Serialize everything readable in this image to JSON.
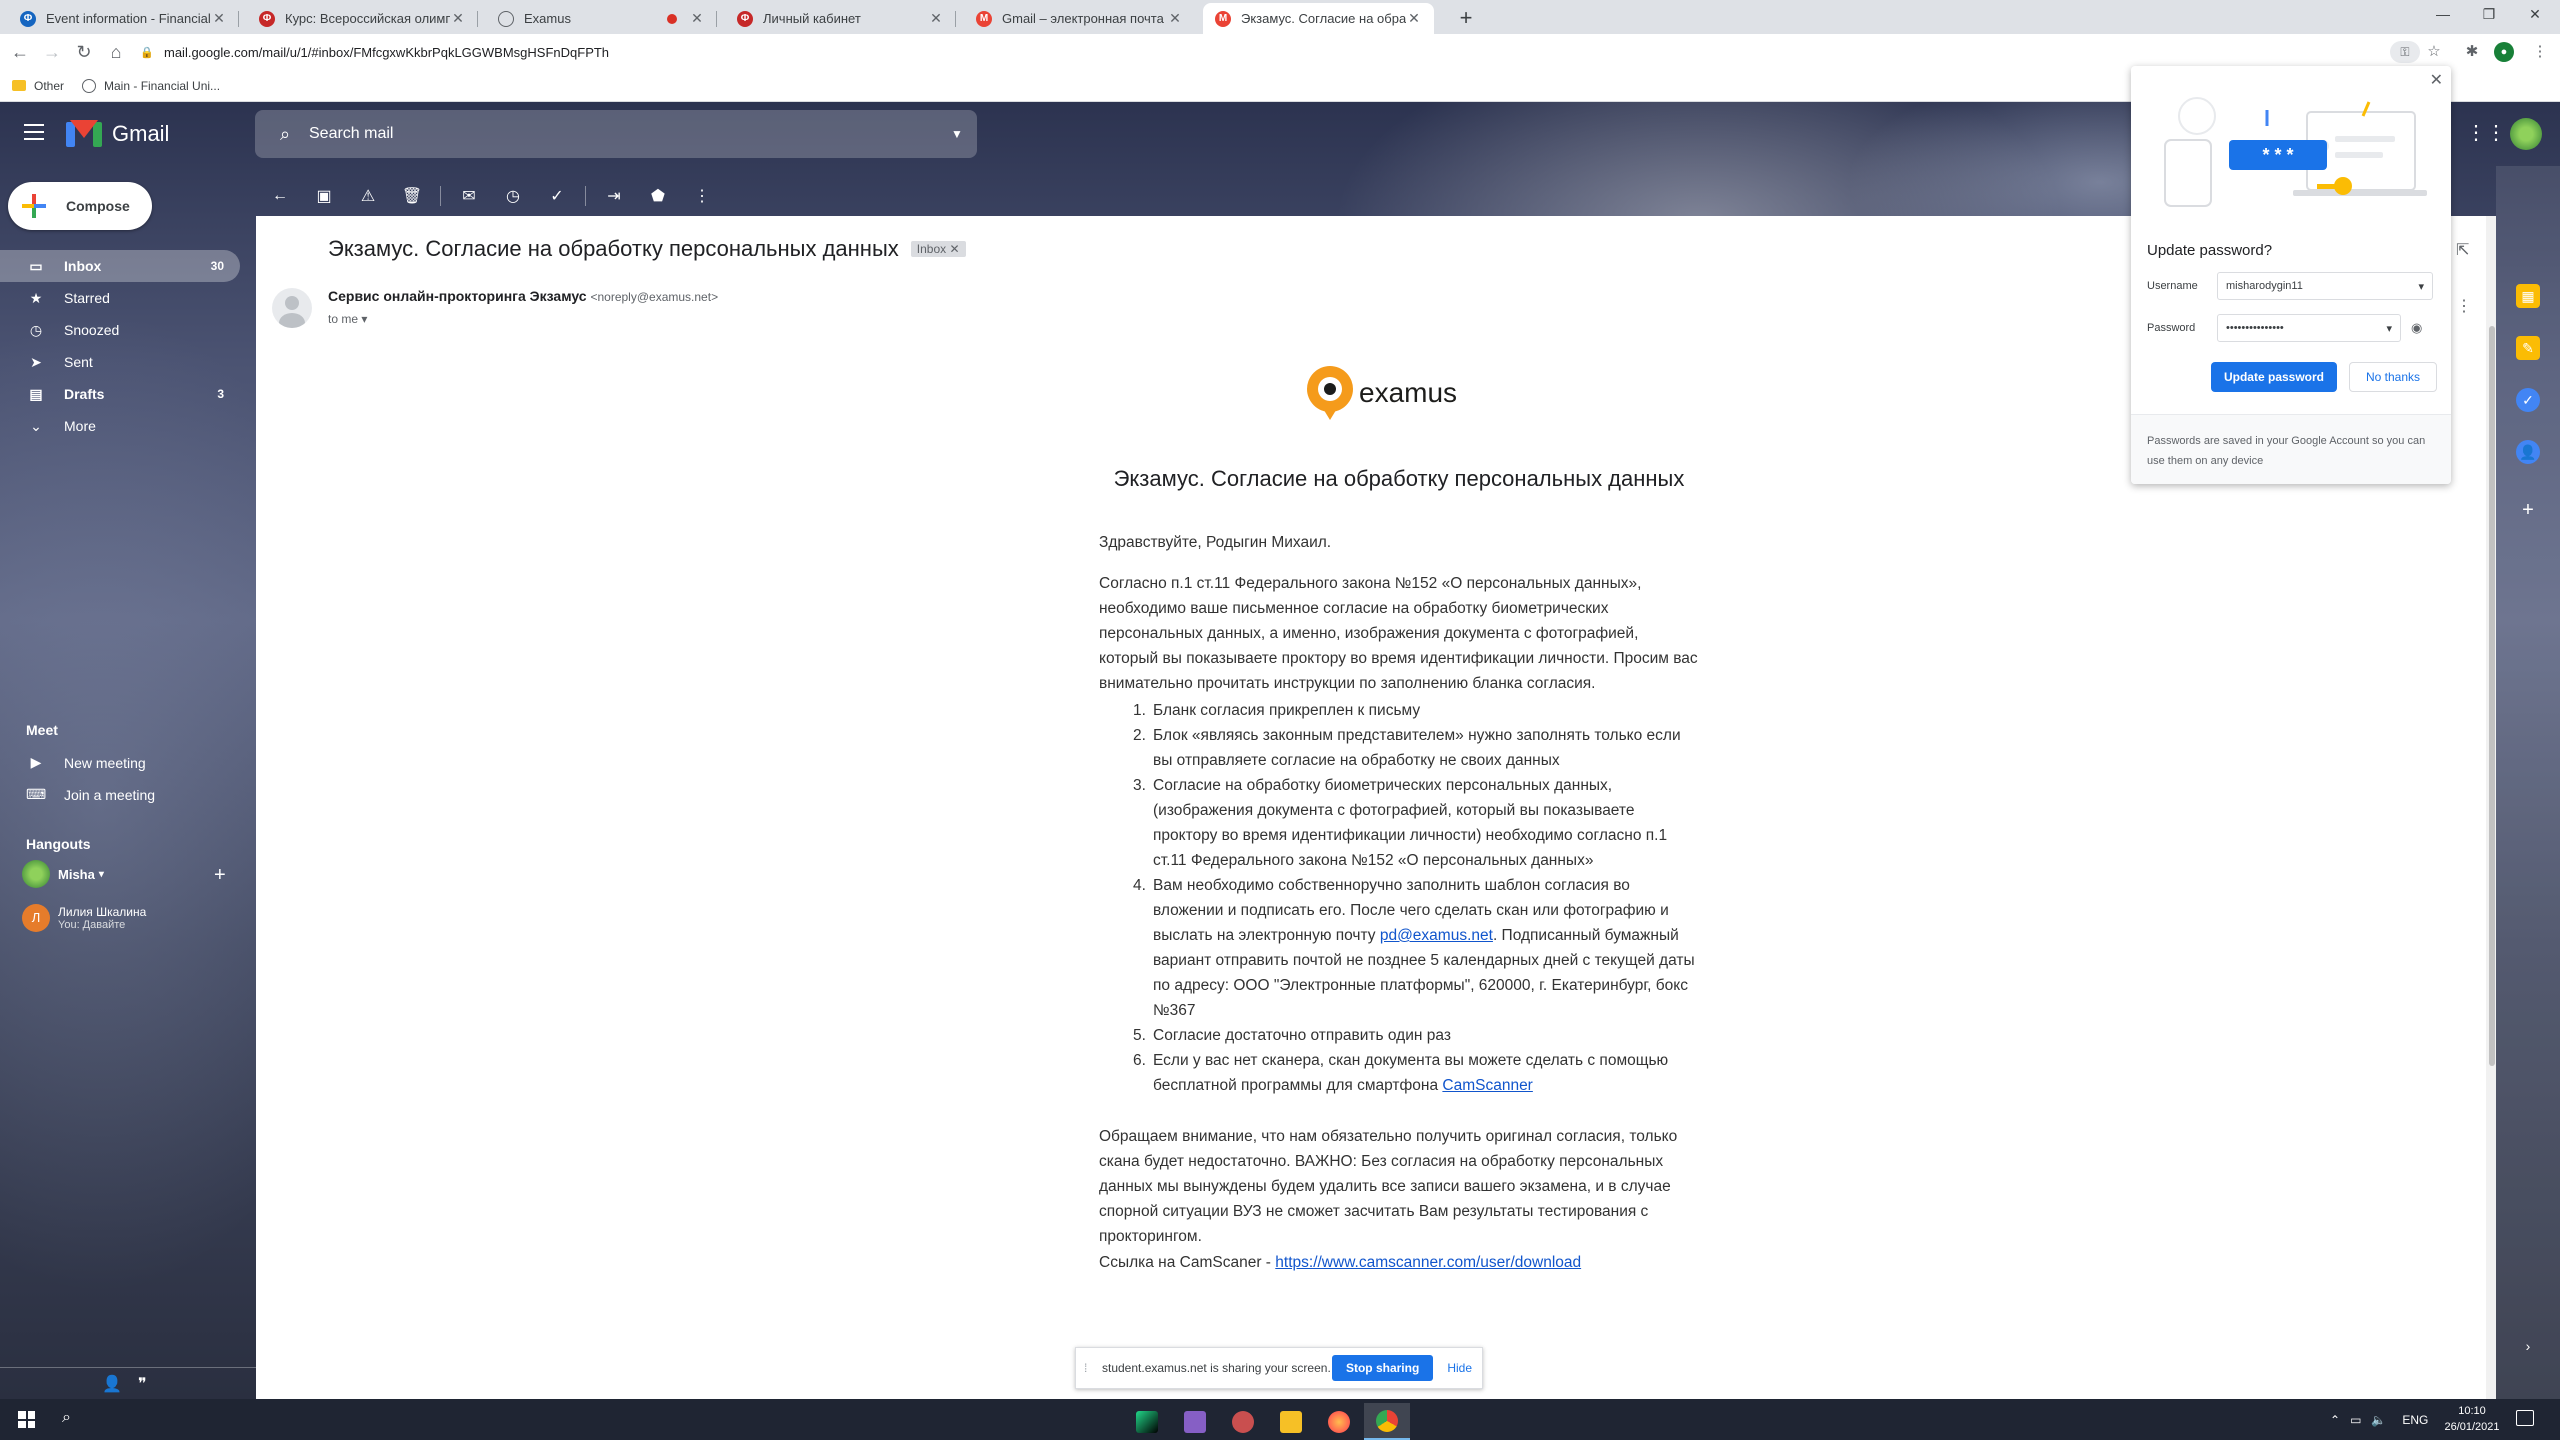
{
  "browser": {
    "tabs": [
      {
        "label": "Event information - Financial Uni",
        "favicon": "fu-icon",
        "color": "#1565c0"
      },
      {
        "label": "Курс: Всероссийская олимпиада",
        "favicon": "fu-icon",
        "color": "#c62828"
      },
      {
        "label": "Examus",
        "favicon": "globe-icon",
        "color": "#5f6368"
      },
      {
        "label": "Личный кабинет",
        "favicon": "fu-icon",
        "color": "#c62828"
      },
      {
        "label": "Gmail – электронная почта от G",
        "favicon": "gmail-icon",
        "color": "#ea4335"
      },
      {
        "label": "Экзамус. Согласие на обработк",
        "favicon": "gmail-icon",
        "color": "#ea4335"
      }
    ],
    "url": "mail.google.com/mail/u/1/#inbox/FMfcgxwKkbrPqkLGGWBMsgHSFnDqFPTh",
    "bookmarks": [
      {
        "label": "Other",
        "icon": "folder-icon"
      },
      {
        "label": "Main - Financial Uni...",
        "icon": "globe-icon"
      }
    ]
  },
  "gmail": {
    "brand": "Gmail",
    "search_placeholder": "Search mail",
    "compose_label": "Compose",
    "nav": [
      {
        "label": "Inbox",
        "count": "30",
        "icon": "inbox-icon"
      },
      {
        "label": "Starred",
        "count": "",
        "icon": "star-icon"
      },
      {
        "label": "Snoozed",
        "count": "",
        "icon": "clock-icon"
      },
      {
        "label": "Sent",
        "count": "",
        "icon": "send-icon"
      },
      {
        "label": "Drafts",
        "count": "3",
        "icon": "draft-icon"
      },
      {
        "label": "More",
        "count": "",
        "icon": "chevron-down-icon"
      }
    ],
    "meet": {
      "title": "Meet",
      "new_meeting": "New meeting",
      "join_meeting": "Join a meeting"
    },
    "hangouts": {
      "title": "Hangouts",
      "user": "Misha",
      "contact_name": "Лилия Шкалина",
      "contact_msg": "You: Давайте"
    }
  },
  "message": {
    "subject": "Экзамус. Согласие на обработку персональных данных",
    "label": "Inbox",
    "sender_name": "Сервис онлайн-прокторинга Экзамус",
    "sender_email": "<noreply@examus.net>",
    "to": "to me",
    "logo_text": "examus",
    "title": "Экзамус. Согласие на обработку персональных данных",
    "greeting": "Здравствуйте, Родыгин Михаил.",
    "intro": "Согласно п.1 ст.11 Федерального закона №152 «О персональных данных», необходимо ваше письменное согласие на обработку биометрических персональных данных, а именно, изображения документа с фотографией, который вы показываете проктору во время идентификации личности. Просим вас внимательно прочитать инструкции по заполнению бланка согласия.",
    "items": [
      {
        "num": "1.",
        "text": "Бланк согласия прикреплен к письму"
      },
      {
        "num": "2.",
        "text": "Блок «являясь законным представителем» нужно заполнять только если вы отправляете согласие на обработку не своих данных"
      },
      {
        "num": "3.",
        "text": "Согласие на обработку биометрических персональных данных, (изображения документа с фотографией, который вы показываете проктору во время идентификации личности) необходимо согласно п.1 ст.11 Федерального закона №152 «О персональных данных»"
      },
      {
        "num": "4.",
        "pre": "Вам необходимо собственноручно заполнить шаблон согласия во вложении и подписать его. После чего сделать скан или фотографию и выслать на электронную почту ",
        "link": "pd@examus.net",
        "post": ". Подписанный бумажный вариант отправить почтой не позднее 5 календарных дней с текущей даты по адресу: ООО \"Электронные платформы\", 620000, г. Екатеринбург, бокс №367"
      },
      {
        "num": "5.",
        "text": "Согласие достаточно отправить один раз"
      },
      {
        "num": "6.",
        "pre": "Если у вас нет сканера, скан документа вы можете сделать с помощью бесплатной программы для смартфона ",
        "link": "CamScanner",
        "post": ""
      }
    ],
    "notice": "Обращаем внимание, что нам обязательно получить оригинал согласия, только скана будет недостаточно. ВАЖНО: Без согласия на обработку персональных данных мы вынуждены будем удалить все записи вашего экзамена, и в случае спорной ситуации ВУЗ не сможет засчитать Вам результаты тестирования с прокторингом.",
    "camscanner_label": "Ссылка на CamScaner - ",
    "camscanner_url": "https://www.camscanner.com/user/download"
  },
  "password_bubble": {
    "title": "Update password?",
    "username_label": "Username",
    "username_value": "misharodygin11",
    "password_label": "Password",
    "password_value": "•••••••••••••••",
    "update_button": "Update password",
    "no_thanks_button": "No thanks",
    "footer": "Passwords are saved in your Google Account so you can use them on any device",
    "illustration_stars": "* * *"
  },
  "share_bar": {
    "text": "student.examus.net is sharing your screen.",
    "stop_button": "Stop sharing",
    "hide_button": "Hide"
  },
  "taskbar": {
    "lang": "ENG",
    "time": "10:10",
    "date": "26/01/2021",
    "apps": [
      "pycharm-icon",
      "visual-studio-icon",
      "settings-app-icon",
      "file-explorer-icon",
      "firefox-icon",
      "chrome-icon"
    ]
  }
}
